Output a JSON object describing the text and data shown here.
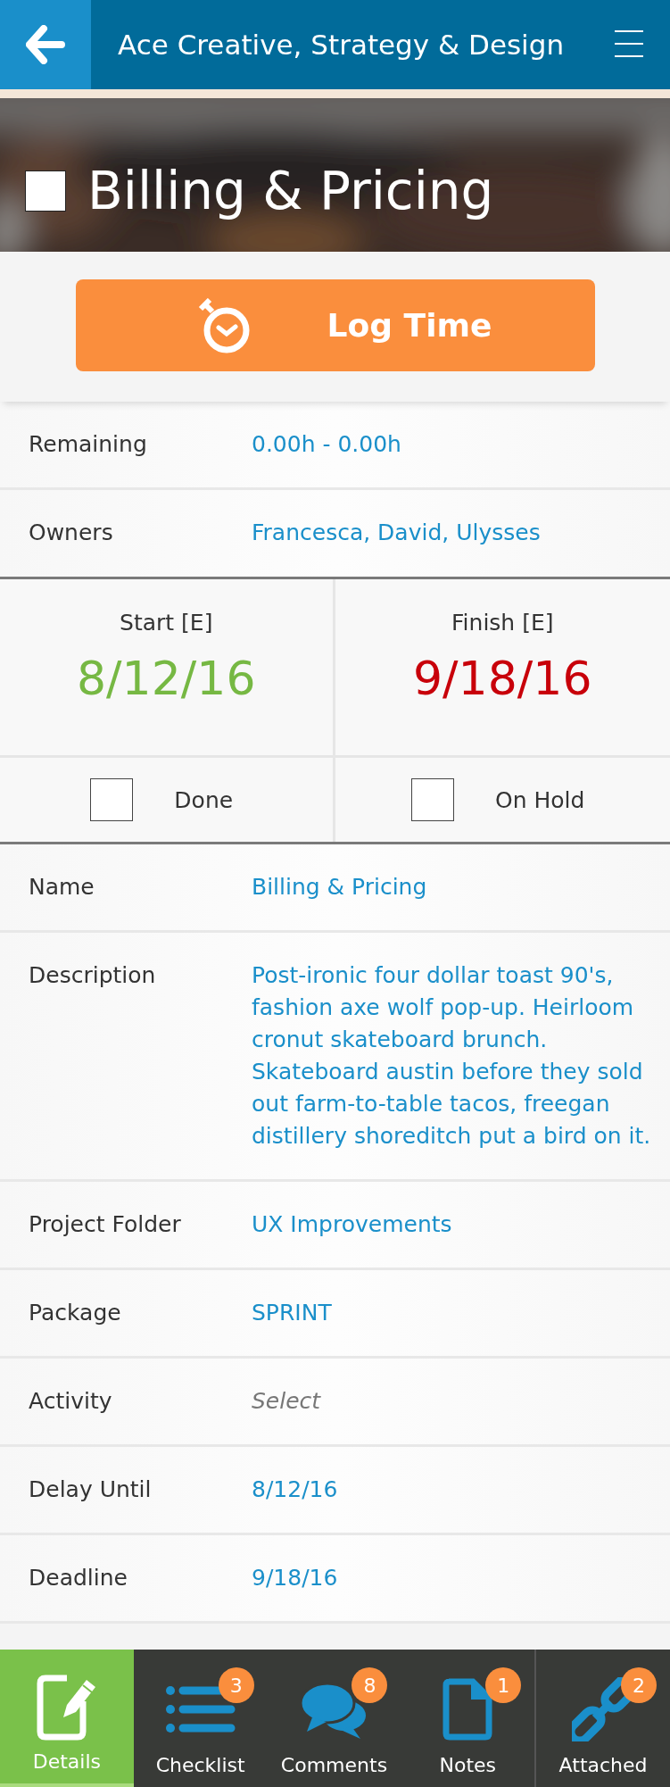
{
  "header": {
    "title": "Ace Creative, Strategy & Design"
  },
  "task": {
    "title": "Billing & Pricing",
    "checked": false
  },
  "log_button": {
    "label": "Log Time"
  },
  "summary_rows": [
    {
      "label": "Remaining",
      "value": "0.00h - 0.00h"
    },
    {
      "label": "Owners",
      "value": "Francesca, David, Ulysses"
    }
  ],
  "dates": [
    {
      "label": "Start [E]",
      "value": "8/12/16",
      "color": "#76b843"
    },
    {
      "label": "Finish [E]",
      "value": "9/18/16",
      "color": "#c8000a"
    }
  ],
  "flags": [
    {
      "label": "Done",
      "checked": false
    },
    {
      "label": "On Hold",
      "checked": false
    }
  ],
  "fields": [
    {
      "label": "Name",
      "value": "Billing & Pricing"
    },
    {
      "label": "Description",
      "value": "Post-ironic four dollar toast 90's, fashion axe wolf pop-up. Heirloom cronut skateboard brunch. Skateboard austin before they sold out farm-to-table tacos, freegan distillery shoreditch put a bird on it."
    },
    {
      "label": "Project Folder",
      "value": "UX Improvements"
    },
    {
      "label": "Package",
      "value": "SPRINT"
    },
    {
      "label": "Activity",
      "placeholder": "Select"
    },
    {
      "label": "Delay Until",
      "value": "8/12/16"
    },
    {
      "label": "Deadline",
      "value": "9/18/16"
    }
  ],
  "tabs": [
    {
      "label": "Details",
      "selected": true
    },
    {
      "label": "Checklist",
      "selected": false,
      "badge": "3"
    },
    {
      "label": "Comments",
      "selected": false,
      "badge": "8"
    },
    {
      "label": "Notes",
      "selected": false,
      "badge": "1"
    },
    {
      "label": "Attached",
      "selected": false,
      "badge": "2"
    }
  ]
}
